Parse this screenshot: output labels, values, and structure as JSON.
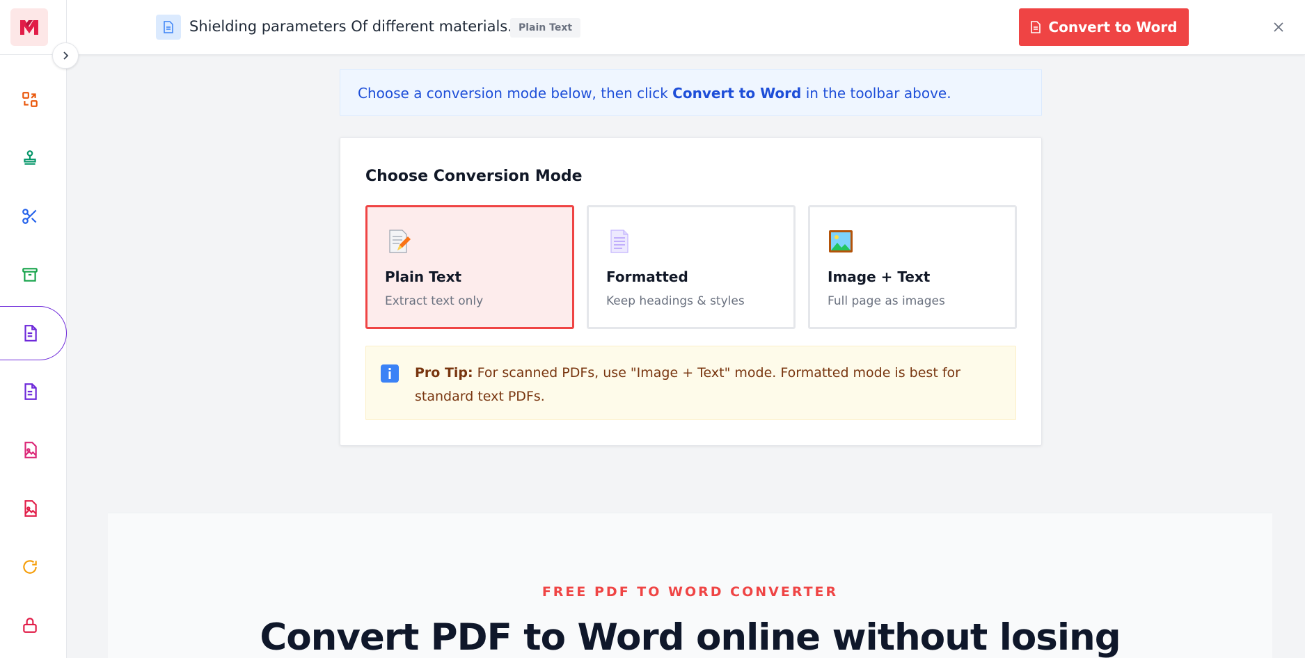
{
  "app": {
    "brand": "M"
  },
  "topbar": {
    "file_name": "Shielding parameters Of different materials.pdf",
    "mode_badge": "Plain Text",
    "convert_label": "Convert to Word"
  },
  "sidebar": {
    "items": [
      {
        "icon": "convert-icon",
        "color": "#ea580c"
      },
      {
        "icon": "stamp-icon",
        "color": "#059669"
      },
      {
        "icon": "scissors-icon",
        "color": "#2563eb"
      },
      {
        "icon": "archive-icon",
        "color": "#16a34a"
      },
      {
        "icon": "document-icon",
        "color": "#6d28d9",
        "active": true
      },
      {
        "icon": "document-text-icon",
        "color": "#6d28d9"
      },
      {
        "icon": "file-image-icon",
        "color": "#db2777"
      },
      {
        "icon": "file-image-icon",
        "color": "#e11d48"
      },
      {
        "icon": "rotate-icon",
        "color": "#f59e0b"
      },
      {
        "icon": "lock-icon",
        "color": "#e11d48"
      }
    ]
  },
  "banner": {
    "prefix": "Choose a conversion mode below, then click ",
    "emphasis": "Convert to Word",
    "suffix": " in the toolbar above."
  },
  "conversion": {
    "title": "Choose Conversion Mode",
    "modes": [
      {
        "title": "Plain Text",
        "desc": "Extract text only",
        "icon": "memo-icon",
        "selected": true
      },
      {
        "title": "Formatted",
        "desc": "Keep headings & styles",
        "icon": "page-icon",
        "selected": false
      },
      {
        "title": "Image + Text",
        "desc": "Full page as images",
        "icon": "picture-icon",
        "selected": false
      }
    ],
    "tip_label": "Pro Tip:",
    "tip_text": " For scanned PDFs, use \"Image + Text\" mode. Formatted mode is best for standard text PDFs."
  },
  "hero": {
    "eyebrow": "FREE PDF TO WORD CONVERTER",
    "title": "Convert PDF to Word online without losing"
  },
  "colors": {
    "accent": "#ef4444",
    "banner_text": "#1d4ed8",
    "tip_text": "#78350f",
    "active_nav": "#6d28d9"
  }
}
